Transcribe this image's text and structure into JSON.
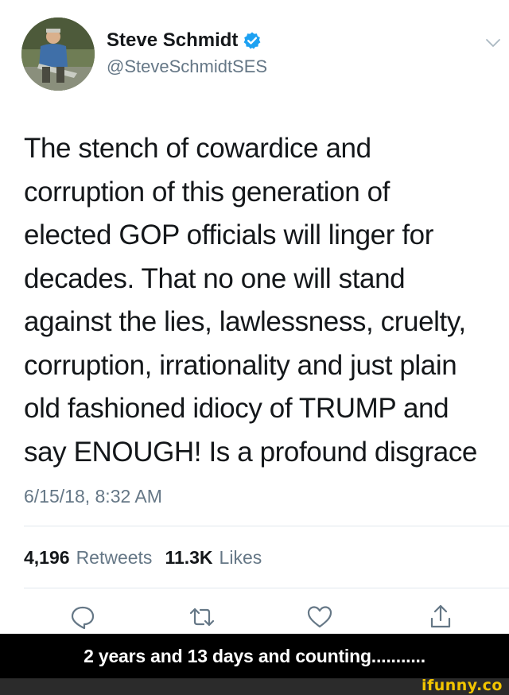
{
  "tweet": {
    "author": {
      "display_name": "Steve Schmidt",
      "handle": "@SteveSchmidtSES",
      "verified": true,
      "verified_color": "#1da1f2"
    },
    "text_lines": [
      "The stench of cowardice and",
      "corruption of this generation of",
      "elected GOP officials will linger for",
      "decades. That no one will stand",
      "against the lies, lawlessness, cruelty,",
      "corruption, irrationality and just plain",
      "old fashioned idiocy of TRUMP and",
      "say ENOUGH! Is a profound disgrace"
    ],
    "timestamp": "6/15/18, 8:32 AM",
    "stats": {
      "retweets_count": "4,196",
      "retweets_label": "Retweets",
      "likes_count": "11.3K",
      "likes_label": "Likes"
    },
    "actions": [
      "reply-icon",
      "retweet-icon",
      "like-icon",
      "share-icon"
    ]
  },
  "caption": "2 years and 13 days and counting...........",
  "watermark": "ifunny.co",
  "colors": {
    "text": "#14171a",
    "secondary": "#657786",
    "divider": "#e1e8ed",
    "caption_bg": "#000000",
    "watermark": "#f2c500"
  }
}
